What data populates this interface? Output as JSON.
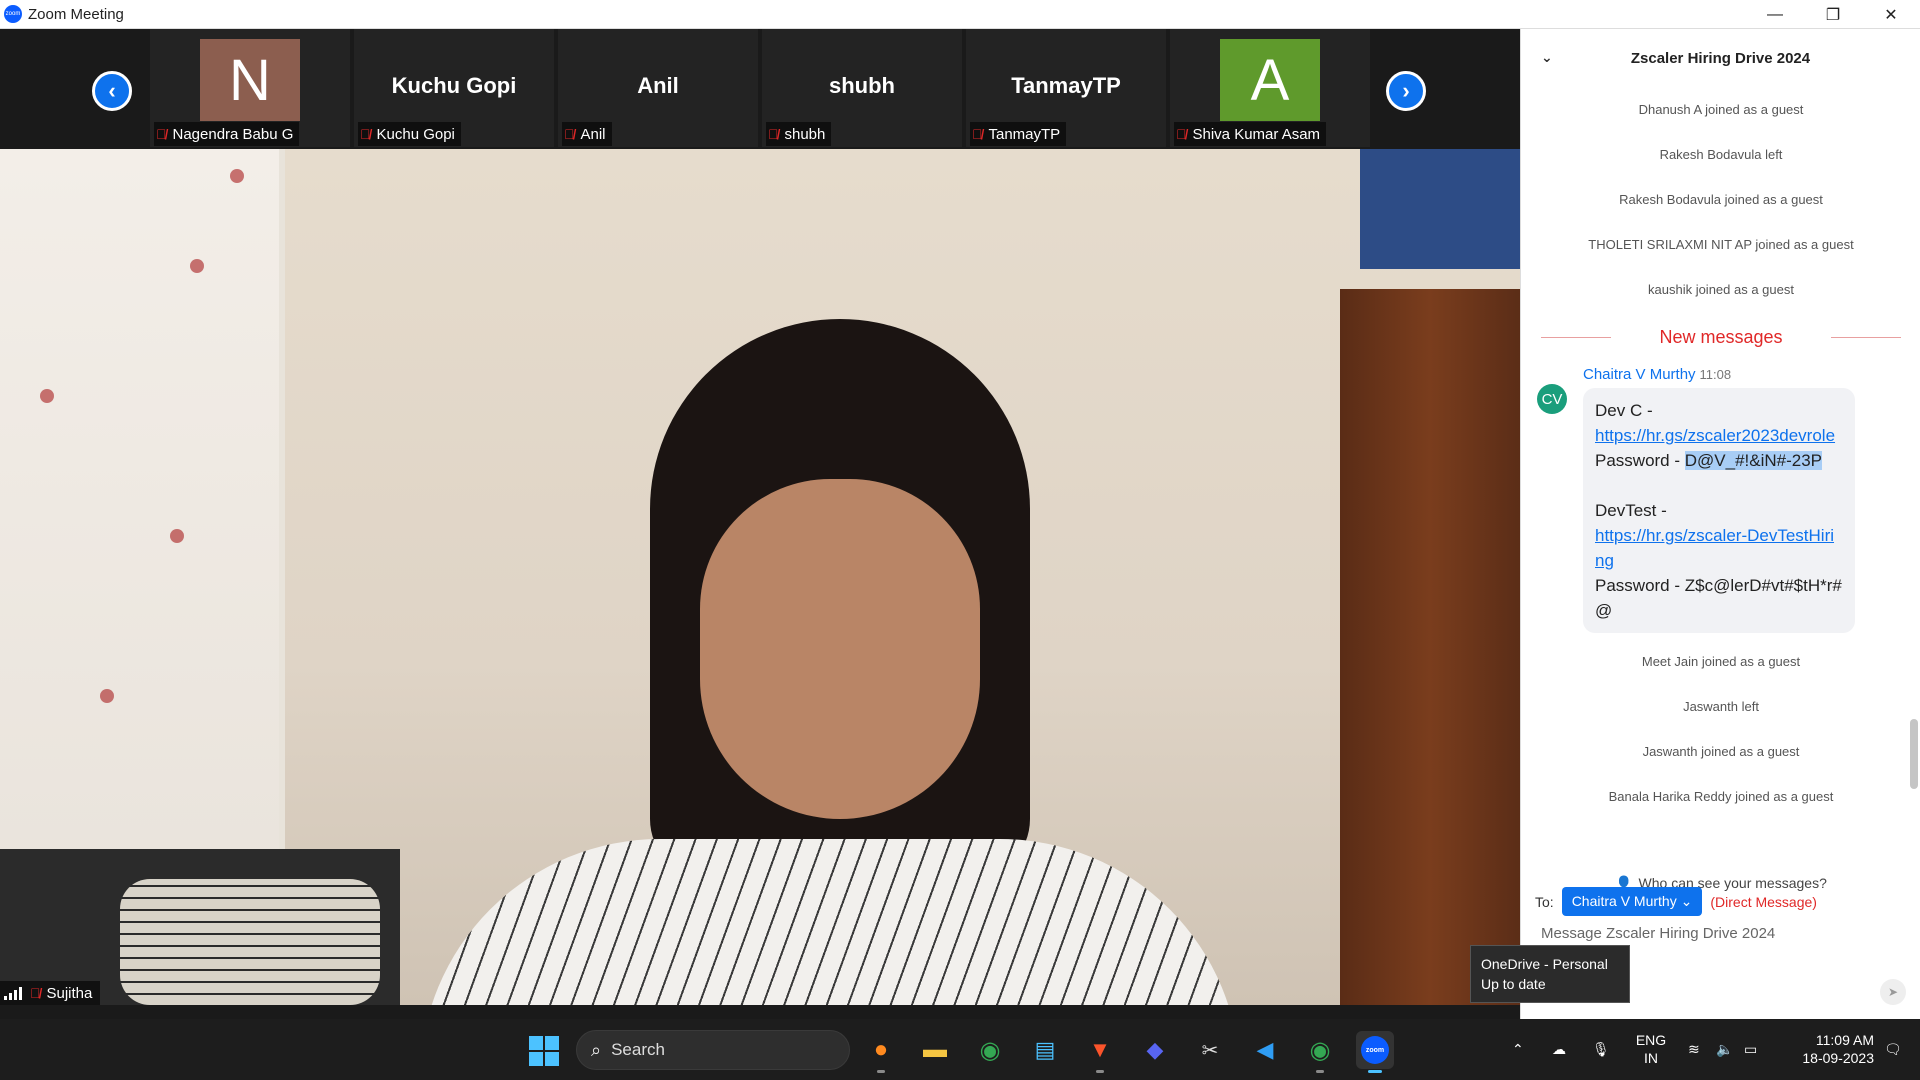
{
  "window": {
    "title": "Zoom Meeting",
    "minimize": "—",
    "restore": "❐",
    "close": "✕"
  },
  "gallery": {
    "prev_arrow": "‹",
    "next_arrow": "›",
    "tiles": [
      {
        "big": "",
        "avatar_letter": "N",
        "avatar_color": "#8c5e4f",
        "label": "Nagendra Babu G"
      },
      {
        "big": "Kuchu Gopi",
        "avatar_letter": "",
        "avatar_color": "",
        "label": "Kuchu Gopi"
      },
      {
        "big": "Anil",
        "avatar_letter": "",
        "avatar_color": "",
        "label": "Anil"
      },
      {
        "big": "shubh",
        "avatar_letter": "",
        "avatar_color": "",
        "label": "shubh"
      },
      {
        "big": "TanmayTP",
        "avatar_letter": "",
        "avatar_color": "",
        "label": "TanmayTP"
      },
      {
        "big": "",
        "avatar_letter": "A",
        "avatar_color": "#5f9a2c",
        "label": "Shiva Kumar Asam"
      }
    ]
  },
  "self_view": {
    "label": "Sujitha"
  },
  "chat": {
    "title": "Zscaler Hiring Drive 2024",
    "system_before": [
      "Dhanush A joined as a guest",
      "Rakesh Bodavula left",
      "Rakesh Bodavula joined as a guest",
      "THOLETI SRILAXMI NIT AP joined as a guest",
      "kaushik joined as a guest"
    ],
    "new_messages": "New messages",
    "message": {
      "avatar": "CV",
      "sender": "Chaitra V Murthy",
      "time": "11:08",
      "line1": "Dev C -",
      "link1": "https://hr.gs/zscaler2023devrole",
      "pw1_label": "Password - ",
      "pw1_value": "D@V_#!&iN#-23P",
      "line2": "DevTest -",
      "link2": "https://hr.gs/zscaler-DevTestHiring",
      "pw2": "Password - Z$c@lerD#vt#$tH*r#@"
    },
    "system_after": [
      "Meet Jain joined as a guest",
      "Jaswanth left",
      "Jaswanth joined as a guest",
      "Banala Harika Reddy joined as a guest"
    ],
    "who_can_see": "Who can see your messages?",
    "to_label": "To:",
    "recipient": "Chaitra V Murthy",
    "direct_message": "(Direct Message)",
    "compose_placeholder": "Message Zscaler Hiring Drive 2024"
  },
  "tooltip": {
    "line1": "OneDrive - Personal",
    "line2": "Up to date"
  },
  "taskbar": {
    "search": "Search",
    "lang_line1": "ENG",
    "lang_line2": "IN",
    "time": "11:09 AM",
    "date": "18-09-2023"
  },
  "colors": {
    "accent": "#0e72ed",
    "mute": "#e02828",
    "new_messages": "#e02828"
  }
}
